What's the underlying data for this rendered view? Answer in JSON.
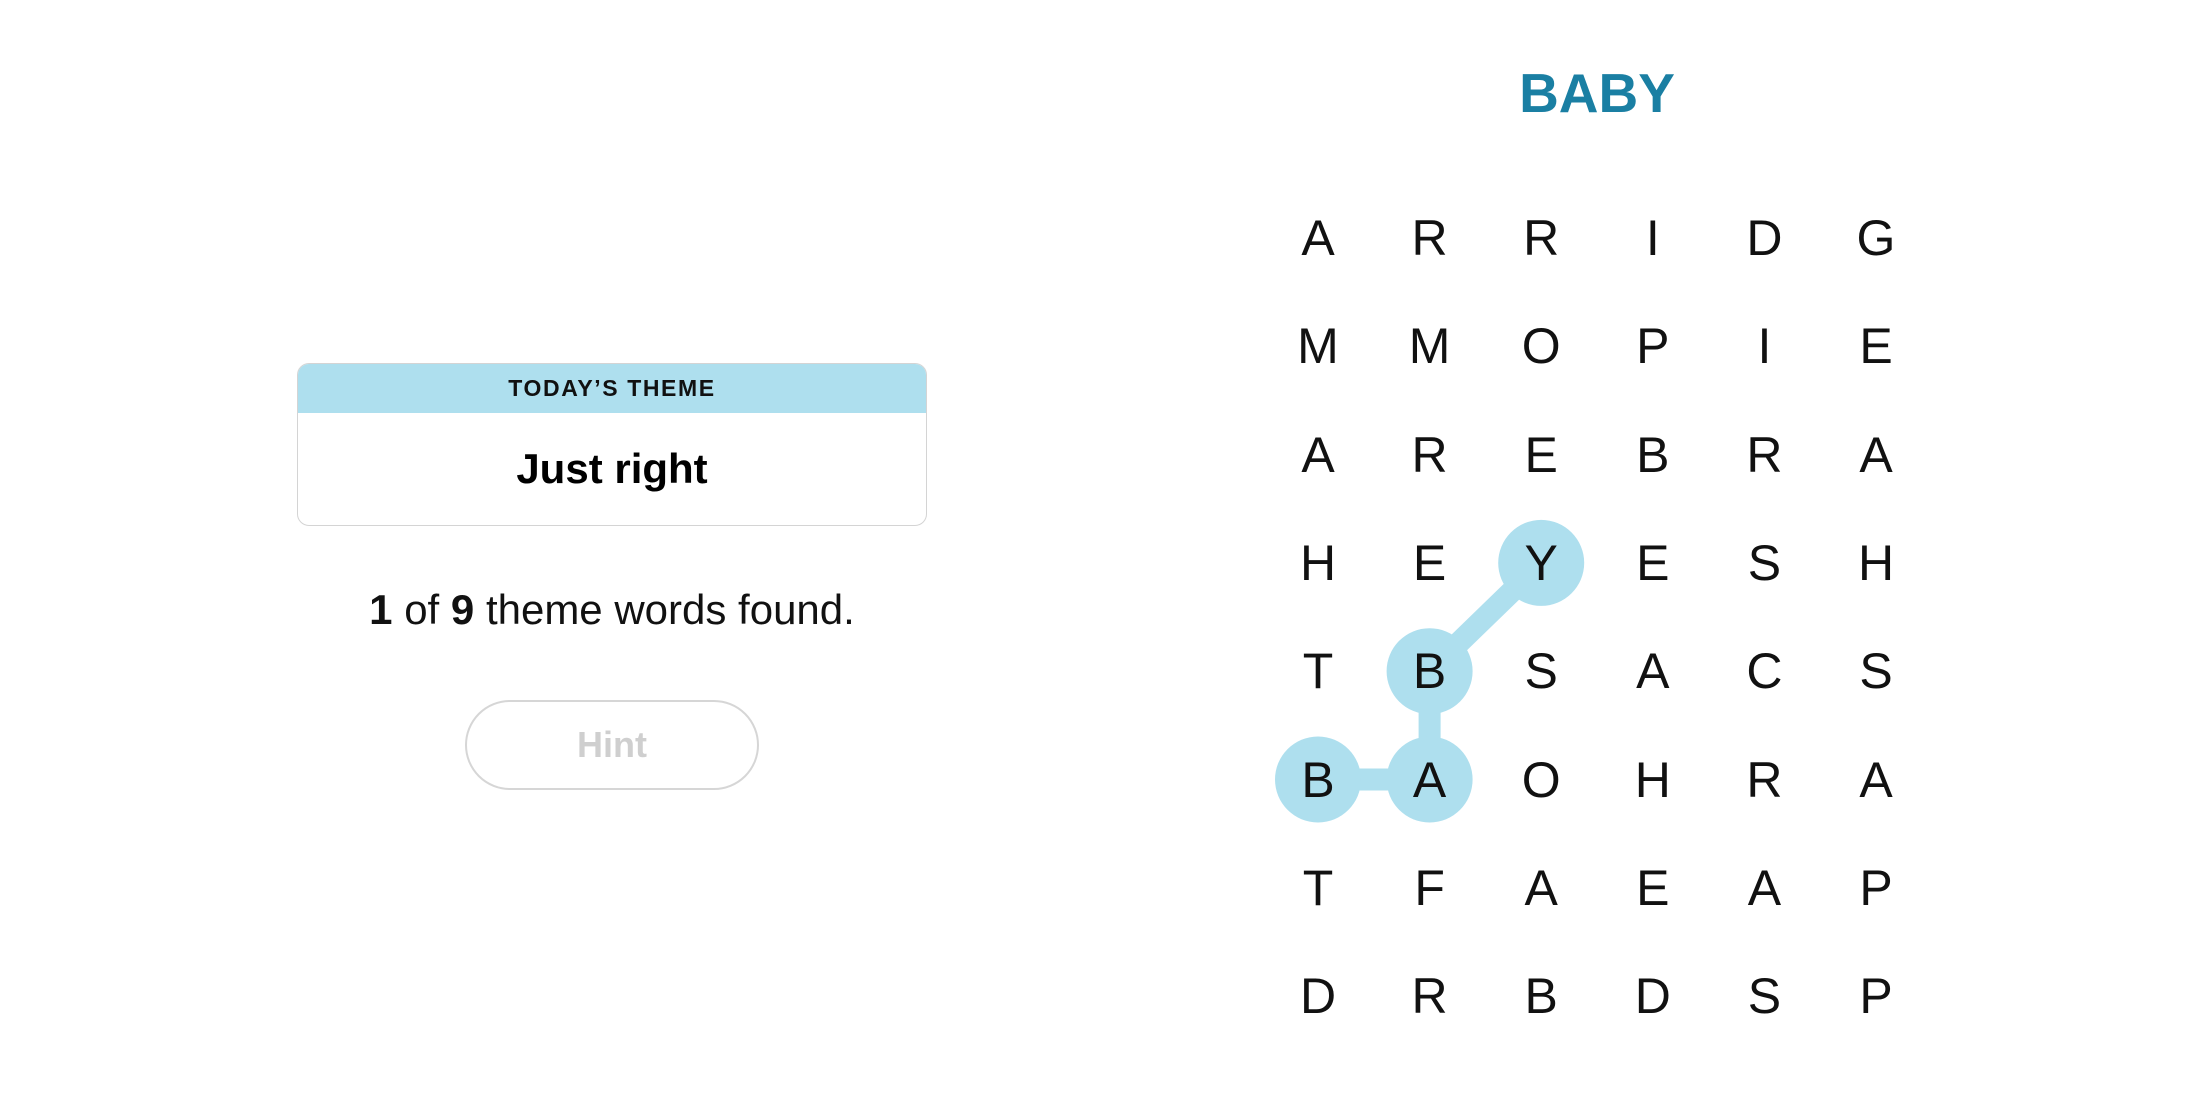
{
  "theme_card": {
    "header_label": "TODAY’S THEME",
    "theme": "Just right"
  },
  "status": {
    "found": "1",
    "of_label": "of",
    "total": "9",
    "suffix": "theme words found."
  },
  "hint_button": {
    "label": "Hint",
    "enabled": false
  },
  "current_word": "BABY",
  "colors": {
    "highlight": "#aedfee",
    "current_word": "#1a7fa3",
    "theme_header_bg": "#aedfee"
  },
  "board": {
    "rows": [
      [
        "A",
        "R",
        "R",
        "I",
        "D",
        "G"
      ],
      [
        "M",
        "M",
        "O",
        "P",
        "I",
        "E"
      ],
      [
        "A",
        "R",
        "E",
        "B",
        "R",
        "A"
      ],
      [
        "H",
        "E",
        "Y",
        "E",
        "S",
        "H"
      ],
      [
        "T",
        "B",
        "S",
        "A",
        "C",
        "S"
      ],
      [
        "B",
        "A",
        "O",
        "H",
        "R",
        "A"
      ],
      [
        "T",
        "F",
        "A",
        "E",
        "A",
        "P"
      ],
      [
        "D",
        "R",
        "B",
        "D",
        "S",
        "P"
      ]
    ],
    "selected_path": [
      {
        "row": 5,
        "col": 0
      },
      {
        "row": 5,
        "col": 1
      },
      {
        "row": 4,
        "col": 1
      },
      {
        "row": 3,
        "col": 2
      }
    ]
  }
}
